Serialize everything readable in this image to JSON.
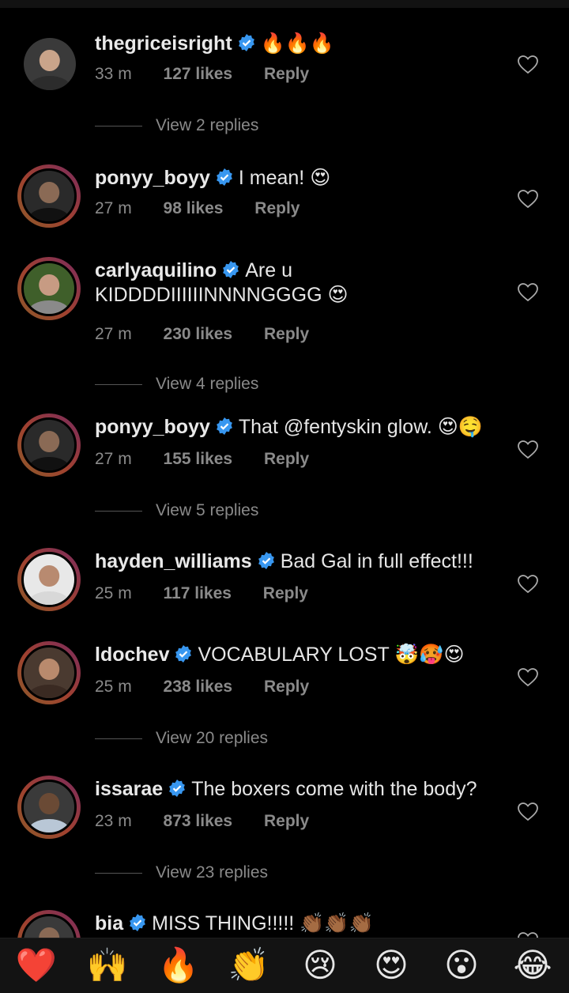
{
  "comments": [
    {
      "username": "thegriceisright",
      "text": "🔥🔥🔥",
      "time": "33 m",
      "likes": "127 likes",
      "reply": "Reply",
      "view_replies": "View 2 replies",
      "avatar_ring": false,
      "avatar_colors": [
        "#3a3a3a",
        "#c9a48a",
        "#2c2c2c"
      ]
    },
    {
      "username": "ponyy_boyy",
      "text": "I mean! 😍",
      "time": "27 m",
      "likes": "98 likes",
      "reply": "Reply",
      "avatar_ring": true,
      "avatar_colors": [
        "#2a2a2a",
        "#8a6a55",
        "#111111"
      ]
    },
    {
      "username": "carlyaquilino",
      "text": "Are u KIDDDDIIIIIINNNNGGGG 😍",
      "time": "27 m",
      "likes": "230 likes",
      "reply": "Reply",
      "view_replies": "View 4 replies",
      "avatar_ring": true,
      "avatar_colors": [
        "#3f5f2a",
        "#c79b83",
        "#8a8a8a"
      ]
    },
    {
      "username": "ponyy_boyy",
      "text": "That @fentyskin glow. 😍🤤",
      "time": "27 m",
      "likes": "155 likes",
      "reply": "Reply",
      "view_replies": "View 5 replies",
      "avatar_ring": true,
      "avatar_colors": [
        "#2a2a2a",
        "#8a6a55",
        "#111111"
      ]
    },
    {
      "username": "hayden_williams",
      "text": "Bad Gal in full effect!!!",
      "time": "25 m",
      "likes": "117 likes",
      "reply": "Reply",
      "avatar_ring": true,
      "avatar_colors": [
        "#e8e8e8",
        "#b88a70",
        "#d8d8d8"
      ]
    },
    {
      "username": "ldochev",
      "text": "VOCABULARY LOST 🤯🥵😍",
      "time": "25 m",
      "likes": "238 likes",
      "reply": "Reply",
      "view_replies": "View 20 replies",
      "avatar_ring": true,
      "avatar_colors": [
        "#4a3a30",
        "#b98a6d",
        "#3a2a22"
      ]
    },
    {
      "username": "issarae",
      "text": "The boxers come with the body?",
      "time": "23 m",
      "likes": "873 likes",
      "reply": "Reply",
      "view_replies": "View 23 replies",
      "avatar_ring": true,
      "avatar_colors": [
        "#3a3a3a",
        "#6a4a35",
        "#b9c7d6"
      ]
    },
    {
      "username": "bia",
      "text": "MISS THING!!!!! 👏🏾👏🏾👏🏾",
      "avatar_ring": true,
      "avatar_colors": [
        "#3a3a3a",
        "#8a6a55",
        "#222222"
      ]
    }
  ],
  "emoji_bar": [
    "❤️",
    "🙌",
    "🔥",
    "👏",
    "😢",
    "😍",
    "😮",
    "😂"
  ],
  "colors": {
    "background": "#000000",
    "verified": "#3897f0",
    "meta_text": "#8a8a8a",
    "emoji_bar_bg": "#131313"
  }
}
